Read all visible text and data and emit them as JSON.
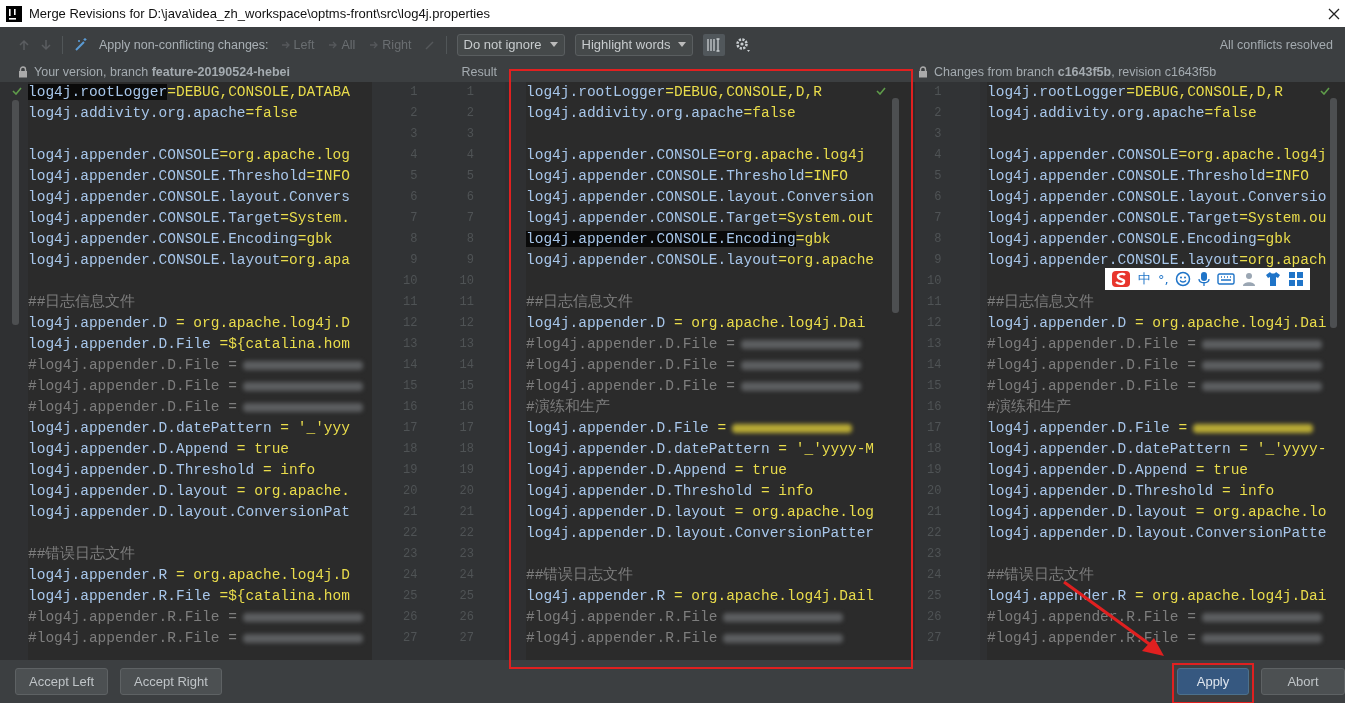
{
  "window": {
    "title": "Merge Revisions for D:\\java\\idea_zh_workspace\\optms-front\\src\\log4j.properties"
  },
  "toolbar": {
    "apply_label": "Apply non-conflicting changes:",
    "apply_targets": [
      {
        "label": "Left",
        "disabled": true
      },
      {
        "label": "All",
        "disabled": true
      },
      {
        "label": "Right",
        "disabled": true
      }
    ],
    "dropdowns": [
      {
        "label": "Do not ignore"
      },
      {
        "label": "Highlight words"
      }
    ],
    "layout_toggle": {
      "selected": true
    },
    "status": "All conflicts resolved"
  },
  "headers": {
    "left": "Your version, branch **feature-20190524-hebei**",
    "result": "Result",
    "right": "Changes from branch **c1643f5b**, revision c1643f5b"
  },
  "panes": [
    {
      "lines": [
        {
          "kind": "code-marked",
          "key": "log4j.rootLogger",
          "value": "=DEBUG,CONSOLE,DATABA"
        },
        {
          "kind": "code",
          "key": "log4j.addivity.org.apache",
          "value": "=false"
        },
        {
          "kind": "blank"
        },
        {
          "kind": "code",
          "key": "log4j.appender.CONSOLE",
          "value": "=org.apache.log"
        },
        {
          "kind": "code",
          "key": "log4j.appender.CONSOLE.Threshold",
          "value": "=INFO"
        },
        {
          "kind": "code",
          "key": "log4j.appender.CONSOLE.layout.Convers"
        },
        {
          "kind": "code",
          "key": "log4j.appender.CONSOLE.Target",
          "value": "=System."
        },
        {
          "kind": "code",
          "key": "log4j.appender.CONSOLE.Encoding",
          "value": "=gbk"
        },
        {
          "kind": "code",
          "key": "log4j.appender.CONSOLE.layout",
          "value": "=org.apa"
        },
        {
          "kind": "blank"
        },
        {
          "kind": "comment",
          "text": "##日志信息文件"
        },
        {
          "kind": "code",
          "key": "log4j.appender.D",
          "value": " = org.apache.log4j.D"
        },
        {
          "kind": "code",
          "key": "log4j.appender.D.File",
          "value": " =${catalina.hom"
        },
        {
          "kind": "redacted",
          "text": "#log4j.appender.D.File ="
        },
        {
          "kind": "redacted",
          "text": "#log4j.appender.D.File ="
        },
        {
          "kind": "redacted",
          "text": "#log4j.appender.D.File ="
        },
        {
          "kind": "code",
          "key": "log4j.appender.D.datePattern",
          "value": " = '_'yyy"
        },
        {
          "kind": "code",
          "key": "log4j.appender.D.Append",
          "value": " = true"
        },
        {
          "kind": "code",
          "key": "log4j.appender.D.Threshold",
          "value": " = info"
        },
        {
          "kind": "code",
          "key": "log4j.appender.D.layout",
          "value": " = org.apache."
        },
        {
          "kind": "code",
          "key": "log4j.appender.D.layout.ConversionPat"
        },
        {
          "kind": "blank"
        },
        {
          "kind": "comment",
          "text": "##错误日志文件"
        },
        {
          "kind": "code",
          "key": "log4j.appender.R",
          "value": " = org.apache.log4j.D"
        },
        {
          "kind": "code",
          "key": "log4j.appender.R.File",
          "value": " =${catalina.hom"
        },
        {
          "kind": "redacted",
          "text": "#log4j.appender.R.File ="
        },
        {
          "kind": "redacted",
          "text": "#log4j.appender.R.File ="
        }
      ]
    },
    {
      "lines": [
        {
          "kind": "code",
          "key": "log4j.rootLogger",
          "value": "=DEBUG,CONSOLE,D,R"
        },
        {
          "kind": "code",
          "key": "log4j.addivity.org.apache",
          "value": "=false"
        },
        {
          "kind": "blank"
        },
        {
          "kind": "code",
          "key": "log4j.appender.CONSOLE",
          "value": "=org.apache.log4j"
        },
        {
          "kind": "code",
          "key": "log4j.appender.CONSOLE.Threshold",
          "value": "=INFO"
        },
        {
          "kind": "code",
          "key": "log4j.appender.CONSOLE.layout.Conversion"
        },
        {
          "kind": "code",
          "key": "log4j.appender.CONSOLE.Target",
          "value": "=System.out"
        },
        {
          "kind": "code-marked",
          "key": "log4j.appender.CONSOLE.Encoding",
          "value": "=gbk"
        },
        {
          "kind": "code",
          "key": "log4j.appender.CONSOLE.layout",
          "value": "=org.apache"
        },
        {
          "kind": "blank"
        },
        {
          "kind": "comment",
          "text": "##日志信息文件"
        },
        {
          "kind": "code",
          "key": "log4j.appender.D",
          "value": " = org.apache.log4j.Dai"
        },
        {
          "kind": "redacted",
          "text": "#log4j.appender.D.File ="
        },
        {
          "kind": "redacted",
          "text": "#log4j.appender.D.File ="
        },
        {
          "kind": "redacted",
          "text": "#log4j.appender.D.File ="
        },
        {
          "kind": "comment",
          "text": "#演练和生产"
        },
        {
          "kind": "code-redacted",
          "key": "log4j.appender.D.File",
          "value": " ="
        },
        {
          "kind": "code",
          "key": "log4j.appender.D.datePattern",
          "value": " = '_'yyyy-M"
        },
        {
          "kind": "code",
          "key": "log4j.appender.D.Append",
          "value": " = true"
        },
        {
          "kind": "code",
          "key": "log4j.appender.D.Threshold",
          "value": " = info"
        },
        {
          "kind": "code",
          "key": "log4j.appender.D.layout",
          "value": " = org.apache.log"
        },
        {
          "kind": "code",
          "key": "log4j.appender.D.layout.ConversionPatter"
        },
        {
          "kind": "blank"
        },
        {
          "kind": "comment",
          "text": "##错误日志文件"
        },
        {
          "kind": "code",
          "key": "log4j.appender.R",
          "value": " = org.apache.log4j.Dail"
        },
        {
          "kind": "redacted",
          "text": "#log4j.appender.R.File"
        },
        {
          "kind": "redacted",
          "text": "#log4j.appender.R.File"
        }
      ]
    },
    {
      "lines": [
        {
          "kind": "code",
          "key": "log4j.rootLogger",
          "value": "=DEBUG,CONSOLE,D,R"
        },
        {
          "kind": "code",
          "key": "log4j.addivity.org.apache",
          "value": "=false"
        },
        {
          "kind": "blank"
        },
        {
          "kind": "code",
          "key": "log4j.appender.CONSOLE",
          "value": "=org.apache.log4j"
        },
        {
          "kind": "code",
          "key": "log4j.appender.CONSOLE.Threshold",
          "value": "=INFO"
        },
        {
          "kind": "code",
          "key": "log4j.appender.CONSOLE.layout.Conversio"
        },
        {
          "kind": "code",
          "key": "log4j.appender.CONSOLE.Target",
          "value": "=System.ou"
        },
        {
          "kind": "code",
          "key": "log4j.appender.CONSOLE.Encoding",
          "value": "=gbk"
        },
        {
          "kind": "code",
          "key": "log4j.appender.CONSOLE.layout",
          "value": "=org.apach"
        },
        {
          "kind": "blank"
        },
        {
          "kind": "comment",
          "text": "##日志信息文件"
        },
        {
          "kind": "code",
          "key": "log4j.appender.D",
          "value": " = org.apache.log4j.Dai"
        },
        {
          "kind": "redacted",
          "text": "#log4j.appender.D.File ="
        },
        {
          "kind": "redacted",
          "text": "#log4j.appender.D.File ="
        },
        {
          "kind": "redacted",
          "text": "#log4j.appender.D.File ="
        },
        {
          "kind": "comment",
          "text": "#演练和生产"
        },
        {
          "kind": "code-redacted",
          "key": "log4j.appender.D.File",
          "value": " ="
        },
        {
          "kind": "code",
          "key": "log4j.appender.D.datePattern",
          "value": " = '_'yyyy-"
        },
        {
          "kind": "code",
          "key": "log4j.appender.D.Append",
          "value": " = true"
        },
        {
          "kind": "code",
          "key": "log4j.appender.D.Threshold",
          "value": " = info"
        },
        {
          "kind": "code",
          "key": "log4j.appender.D.layout",
          "value": " = org.apache.lo"
        },
        {
          "kind": "code",
          "key": "log4j.appender.D.layout.ConversionPatte"
        },
        {
          "kind": "blank"
        },
        {
          "kind": "comment",
          "text": "##错误日志文件"
        },
        {
          "kind": "code",
          "key": "log4j.appender.R",
          "value": " = org.apache.log4j.Dai"
        },
        {
          "kind": "redacted",
          "text": "#log4j.appender.R.File ="
        },
        {
          "kind": "redacted",
          "text": "#log4j.appender.R.File ="
        }
      ]
    }
  ],
  "gutters": [
    {
      "columns": [
        [
          "1",
          "2",
          "3",
          "4",
          "5",
          "6",
          "7",
          "8",
          "9",
          "10",
          "11",
          "12",
          "13",
          "14",
          "15",
          "16",
          "17",
          "18",
          "19",
          "20",
          "21",
          "22",
          "23",
          "24",
          "25",
          "26",
          "27"
        ],
        [
          "1",
          "2",
          "3",
          "4",
          "5",
          "6",
          "7",
          "8",
          "9",
          "10",
          "11",
          "12",
          "13",
          "14",
          "15",
          "16",
          "17",
          "18",
          "19",
          "20",
          "21",
          "22",
          "23",
          "24",
          "25",
          "26",
          "27"
        ]
      ]
    },
    {
      "columns": [
        [
          "1",
          "2",
          "3",
          "4",
          "5",
          "6",
          "7",
          "8",
          "9",
          "10",
          "11",
          "12",
          "13",
          "14",
          "15",
          "16",
          "17",
          "18",
          "19",
          "20",
          "21",
          "22",
          "23",
          "24",
          "25",
          "26",
          "27"
        ]
      ]
    }
  ],
  "ime_toolbar": {
    "labels": [
      "中",
      "°,"
    ]
  },
  "bottom": {
    "left_buttons": [
      {
        "label": "Accept Left",
        "kind": "plain"
      },
      {
        "label": "Accept Right",
        "kind": "plain"
      }
    ],
    "right_buttons": [
      {
        "label": "Apply",
        "kind": "primary"
      },
      {
        "label": "Abort",
        "kind": "plain"
      }
    ]
  }
}
